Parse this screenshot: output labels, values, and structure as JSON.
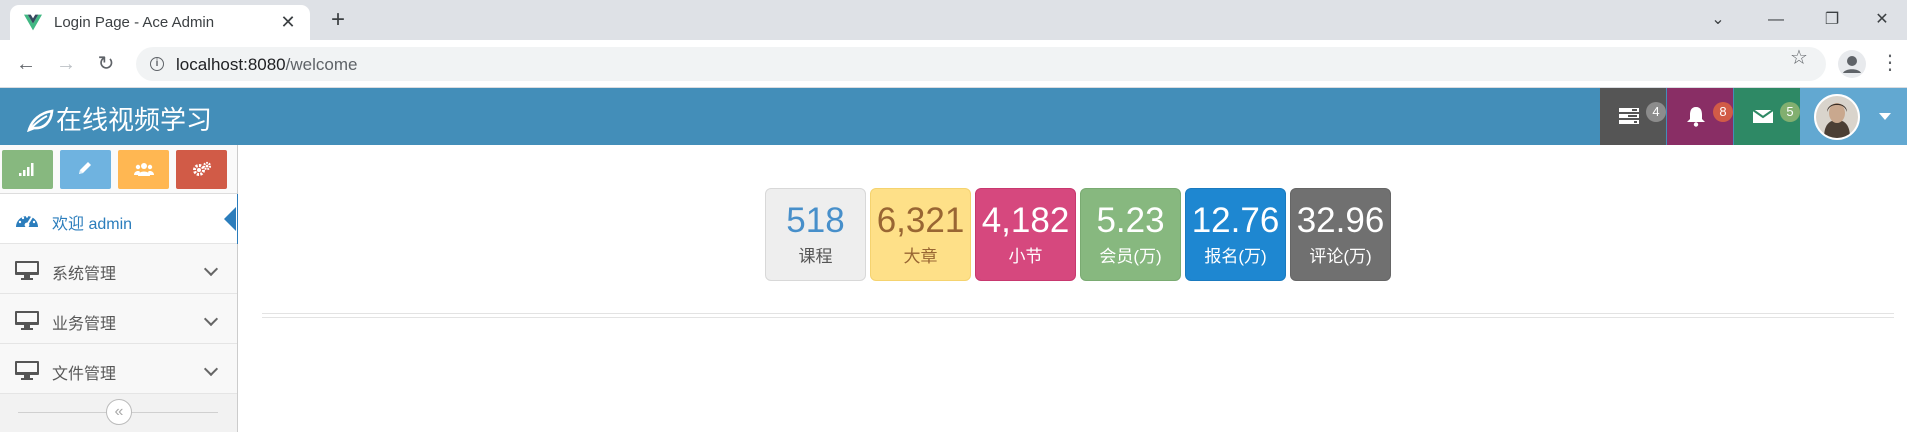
{
  "browser": {
    "tab_title": "Login Page - Ace Admin",
    "url_host": "localhost:8080",
    "url_path": "/welcome",
    "icons": [
      "vue-favicon-icon",
      "close-icon",
      "plus-icon",
      "chevron-down-icon",
      "minimize-icon",
      "restore-icon",
      "window-close-icon",
      "back-icon",
      "forward-icon",
      "reload-icon",
      "info-icon",
      "star-icon",
      "profile-icon",
      "kebab-icon"
    ]
  },
  "navbar": {
    "brand": "在线视频学习",
    "brand_icon": "leaf-icon",
    "badges": [
      {
        "icon": "tasks-icon",
        "count": "4",
        "color": "#555555",
        "badge_color": "#8c8c8c"
      },
      {
        "icon": "bell-icon",
        "count": "8",
        "color": "#892e65",
        "badge_color": "#d15b47"
      },
      {
        "icon": "envelope-icon",
        "count": "5",
        "color": "#2e8965",
        "badge_color": "#82af6f"
      }
    ],
    "user_icon": "avatar",
    "accent": "#438eb9"
  },
  "sidebar": {
    "shortcuts": [
      {
        "icon": "signal-icon",
        "color": "#87b87f"
      },
      {
        "icon": "pencil-icon",
        "color": "#6fb3e0"
      },
      {
        "icon": "users-icon",
        "color": "#ffb752"
      },
      {
        "icon": "cogs-icon",
        "color": "#d15b47"
      }
    ],
    "items": [
      {
        "label": "欢迎 admin",
        "icon": "tachometer-icon",
        "active": true
      },
      {
        "label": "系统管理",
        "icon": "desktop-icon",
        "active": false
      },
      {
        "label": "业务管理",
        "icon": "desktop-icon",
        "active": false
      },
      {
        "label": "文件管理",
        "icon": "desktop-icon",
        "active": false
      }
    ],
    "collapse_icon": "double-angle-left-icon",
    "collapse_glyph": "«"
  },
  "stats": [
    {
      "value": "518",
      "label": "课程",
      "bg": "#eeeeee",
      "border": "#d8d8d8",
      "value_color": "#478fca",
      "label_color": "#555555"
    },
    {
      "value": "6,321",
      "label": "大章",
      "bg": "#fee088",
      "border": "#f5d36f",
      "value_color": "#996633",
      "label_color": "#996633"
    },
    {
      "value": "4,182",
      "label": "小节",
      "bg": "#d6487e",
      "border": "#c8386f",
      "value_color": "#ffffff",
      "label_color": "#ffffff"
    },
    {
      "value": "5.23",
      "label": "会员(万)",
      "bg": "#87b87f",
      "border": "#7aab72",
      "value_color": "#ffffff",
      "label_color": "#ffffff"
    },
    {
      "value": "12.76",
      "label": "报名(万)",
      "bg": "#1e87d1",
      "border": "#1a7abf",
      "value_color": "#ffffff",
      "label_color": "#ffffff"
    },
    {
      "value": "32.96",
      "label": "评论(万)",
      "bg": "#707070",
      "border": "#666666",
      "value_color": "#ffffff",
      "label_color": "#ffffff"
    }
  ]
}
